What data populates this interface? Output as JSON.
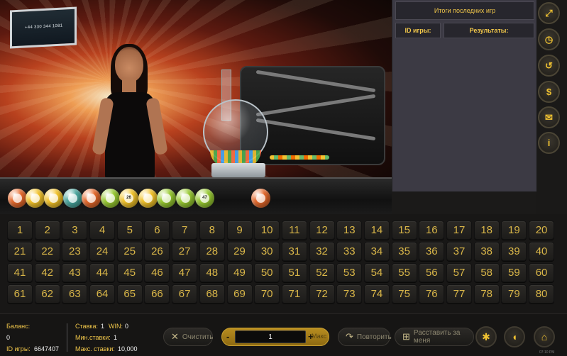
{
  "overlay": {
    "phone": "+44 330 344 1081"
  },
  "tray_balls": [
    {
      "number": "",
      "color": "#e86a2c"
    },
    {
      "number": "",
      "color": "#f5c52a"
    },
    {
      "number": "",
      "color": "#f5c52a"
    },
    {
      "number": "",
      "color": "#4aa8a0"
    },
    {
      "number": "",
      "color": "#e86a2c"
    },
    {
      "number": "",
      "color": "#9acd32"
    },
    {
      "number": "26",
      "color": "#f5c52a"
    },
    {
      "number": "",
      "color": "#f5c52a"
    },
    {
      "number": "",
      "color": "#9acd32"
    },
    {
      "number": "",
      "color": "#9acd32"
    },
    {
      "number": "47",
      "color": "#9acd32"
    },
    {
      "number": "",
      "color": "#e86a2c"
    }
  ],
  "results": {
    "title": "Итоги последних игр",
    "col_id": "ID игры:",
    "col_results": "Результаты:"
  },
  "side_icons": [
    {
      "name": "fullscreen-icon",
      "glyph": "⤢"
    },
    {
      "name": "history-icon",
      "glyph": "◷"
    },
    {
      "name": "history-back-icon",
      "glyph": "↺"
    },
    {
      "name": "cashier-icon",
      "glyph": "$"
    },
    {
      "name": "chat-icon",
      "glyph": "✉"
    },
    {
      "name": "info-icon",
      "glyph": "i"
    }
  ],
  "numbers": [
    "1",
    "2",
    "3",
    "4",
    "5",
    "6",
    "7",
    "8",
    "9",
    "10",
    "11",
    "12",
    "13",
    "14",
    "15",
    "16",
    "17",
    "18",
    "19",
    "20",
    "21",
    "22",
    "23",
    "24",
    "25",
    "26",
    "27",
    "28",
    "29",
    "30",
    "31",
    "32",
    "33",
    "34",
    "35",
    "36",
    "37",
    "38",
    "39",
    "40",
    "41",
    "42",
    "43",
    "44",
    "45",
    "46",
    "47",
    "48",
    "49",
    "50",
    "51",
    "52",
    "53",
    "54",
    "55",
    "56",
    "57",
    "58",
    "59",
    "60",
    "61",
    "62",
    "63",
    "64",
    "65",
    "66",
    "67",
    "68",
    "69",
    "70",
    "71",
    "72",
    "73",
    "74",
    "75",
    "76",
    "77",
    "78",
    "79",
    "80"
  ],
  "footer": {
    "balance_label": "Баланс:",
    "balance_value": "0",
    "game_id_label": "ID игры:",
    "game_id_value": "6647407",
    "bet_label": "Ставка:",
    "bet_value": "1",
    "win_label": "WIN:",
    "win_value": "0",
    "min_bet_label": "Мин.ставки:",
    "min_bet_value": "1",
    "max_bet_label": "Макс. ставки:",
    "max_bet_value": "10,000",
    "clear_label": "Очистить",
    "stake_value": "1",
    "minus": "-",
    "plus": "+",
    "max_label": "Макс",
    "repeat_label": "Повторить",
    "auto_label": "Расставить за меня",
    "clock": "07:10 PM"
  },
  "colors": {
    "accent": "#f0c231",
    "panel": "#3c3a44",
    "cell_text": "#d9b648"
  }
}
